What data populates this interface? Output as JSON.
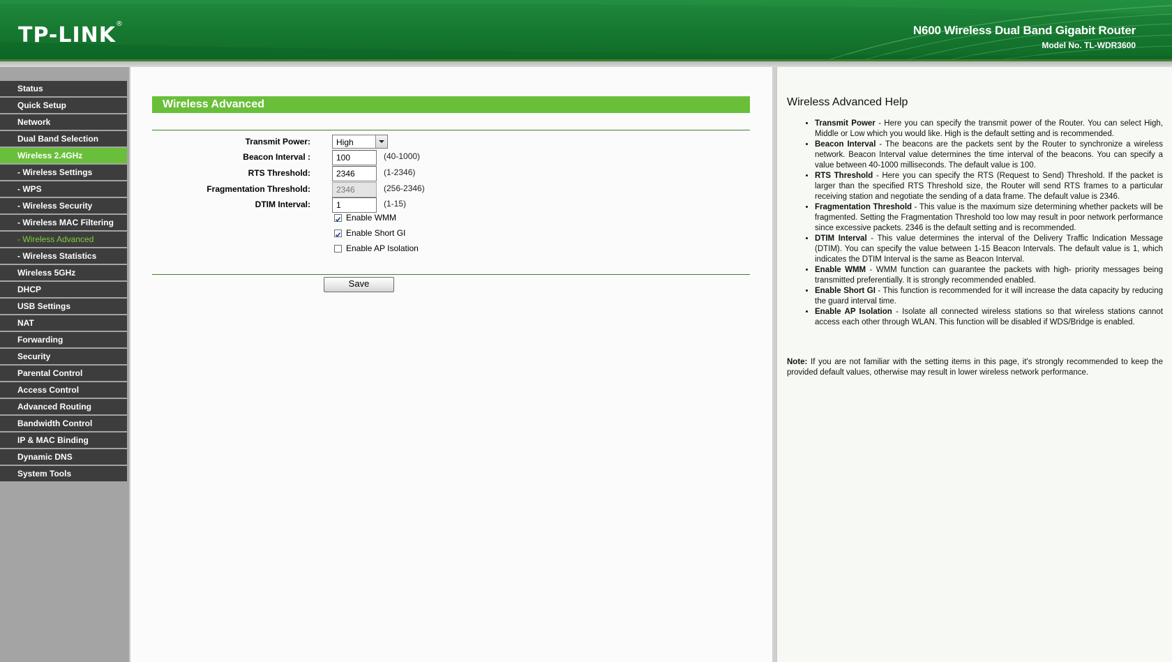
{
  "header": {
    "logo": "TP-LINK",
    "logo_mark": "®",
    "product_name": "N600 Wireless Dual Band Gigabit Router",
    "model_no": "Model No. TL-WDR3600",
    "colors": {
      "brand_green": "#1a7f35",
      "accent_green": "#6abf3a"
    }
  },
  "sidebar": {
    "items": [
      {
        "label": "Status"
      },
      {
        "label": "Quick Setup"
      },
      {
        "label": "Network"
      },
      {
        "label": "Dual Band Selection"
      },
      {
        "label": "Wireless 2.4GHz"
      },
      {
        "label": "- Wireless Settings"
      },
      {
        "label": "- WPS"
      },
      {
        "label": "- Wireless Security"
      },
      {
        "label": "- Wireless MAC Filtering"
      },
      {
        "label": "- Wireless Advanced"
      },
      {
        "label": "- Wireless Statistics"
      },
      {
        "label": "Wireless 5GHz"
      },
      {
        "label": "DHCP"
      },
      {
        "label": "USB Settings"
      },
      {
        "label": "NAT"
      },
      {
        "label": "Forwarding"
      },
      {
        "label": "Security"
      },
      {
        "label": "Parental Control"
      },
      {
        "label": "Access Control"
      },
      {
        "label": "Advanced Routing"
      },
      {
        "label": "Bandwidth Control"
      },
      {
        "label": "IP & MAC Binding"
      },
      {
        "label": "Dynamic DNS"
      },
      {
        "label": "System Tools"
      }
    ]
  },
  "main": {
    "title": "Wireless Advanced",
    "transmit_power": {
      "label": "Transmit Power:",
      "value": "High"
    },
    "beacon_interval": {
      "label": "Beacon Interval :",
      "value": "100",
      "hint": "(40-1000)"
    },
    "rts_threshold": {
      "label": "RTS Threshold:",
      "value": "2346",
      "hint": "(1-2346)"
    },
    "fragmentation_threshold": {
      "label": "Fragmentation Threshold:",
      "value": "2346",
      "hint": "(256-2346)"
    },
    "dtim_interval": {
      "label": "DTIM Interval:",
      "value": "1",
      "hint": "(1-15)"
    },
    "enable_wmm": {
      "label": "Enable WMM",
      "checked": true
    },
    "enable_short_gi": {
      "label": "Enable Short GI",
      "checked": true
    },
    "enable_ap_isolation": {
      "label": "Enable AP Isolation",
      "checked": false
    },
    "save_label": "Save"
  },
  "help": {
    "title": "Wireless Advanced Help",
    "items": [
      {
        "term": "Transmit Power",
        "text": " - Here you can specify the transmit power of the Router. You can select High, Middle or Low which you would like. High is the default setting and is recommended."
      },
      {
        "term": "Beacon Interval",
        "text": " - The beacons are the packets sent by the Router to synchronize a wireless network. Beacon Interval value determines the time interval of the beacons. You can specify a value between 40-1000 milliseconds. The default value is 100."
      },
      {
        "term": "RTS Threshold",
        "text": " - Here you can specify the RTS (Request to Send) Threshold. If the packet is larger than the specified RTS Threshold size, the Router will send RTS frames to a particular receiving station and negotiate the sending of a data frame. The default value is 2346."
      },
      {
        "term": "Fragmentation Threshold",
        "text": " - This value is the maximum size determining whether packets will be fragmented. Setting the Fragmentation Threshold too low may result in poor network performance since excessive packets. 2346 is the default setting and is recommended."
      },
      {
        "term": "DTIM Interval",
        "text": " - This value determines the interval of the Delivery Traffic Indication Message (DTIM). You can specify the value between 1-15 Beacon Intervals. The default value is 1, which indicates the DTIM Interval is the same as Beacon Interval."
      },
      {
        "term": "Enable WMM",
        "text": " - WMM function can guarantee the packets with high- priority messages being transmitted preferentially. It is strongly recommended enabled."
      },
      {
        "term": "Enable Short GI",
        "text": " - This function is recommended for it will increase the data capacity by reducing the guard interval time."
      },
      {
        "term": "Enable AP Isolation",
        "text": " - Isolate all connected wireless stations so that wireless stations cannot access each other through WLAN. This function will be disabled if WDS/Bridge is enabled."
      }
    ],
    "note_label": "Note:",
    "note_text": " If you are not familiar with the setting items in this page, it's strongly recommended to keep the provided default values, otherwise may result in lower wireless network performance."
  }
}
